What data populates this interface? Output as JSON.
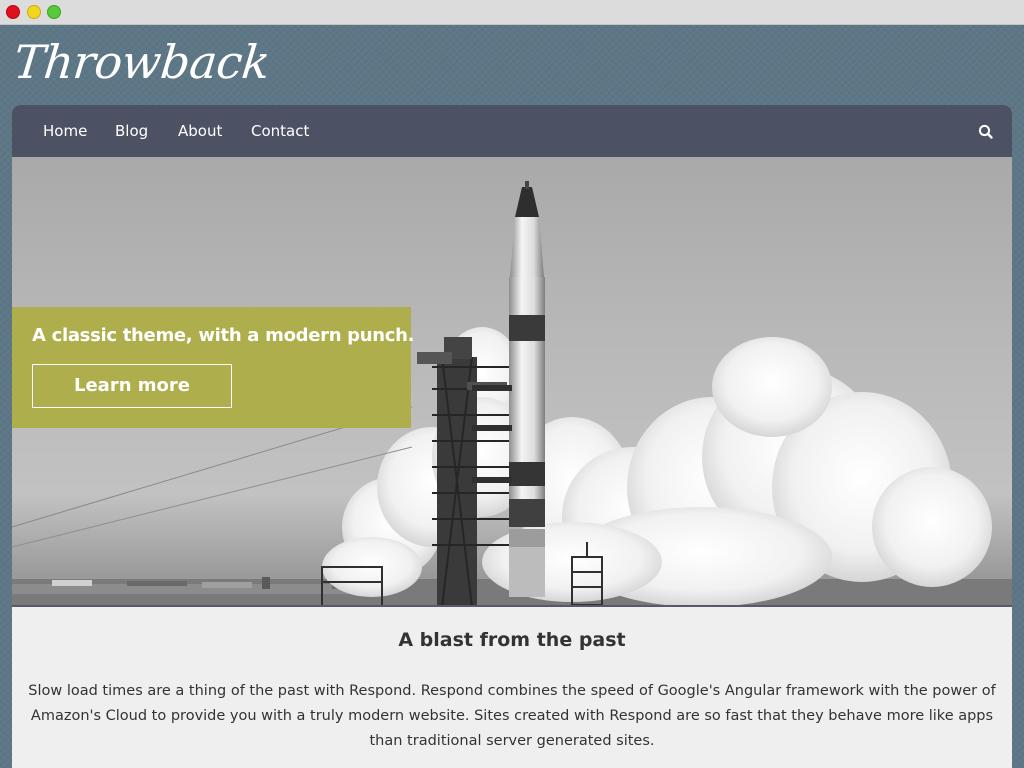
{
  "window": {
    "controls": [
      "close",
      "minimize",
      "maximize"
    ]
  },
  "site": {
    "logo": "Throwback"
  },
  "nav": {
    "items": [
      {
        "label": "Home"
      },
      {
        "label": "Blog"
      },
      {
        "label": "About"
      },
      {
        "label": "Contact"
      }
    ],
    "search_icon": "search-icon"
  },
  "hero": {
    "image": "black-and-white rocket launch photograph",
    "heading": "A classic theme, with a modern punch.",
    "button_label": "Learn more",
    "promo_color": "#aeae4c"
  },
  "content": {
    "title": "A blast from the past",
    "body": "Slow load times are a thing of the past with Respond.  Respond combines the speed of Google's Angular framework with the power of Amazon's Cloud to provide you with a truly modern website.  Sites created with Respond are so fast that they behave more like apps than traditional server generated sites."
  },
  "colors": {
    "background": "#5d7786",
    "navbar": "#4c5264",
    "panel": "#efefef",
    "accent": "#aeae4c",
    "text": "#333333"
  }
}
